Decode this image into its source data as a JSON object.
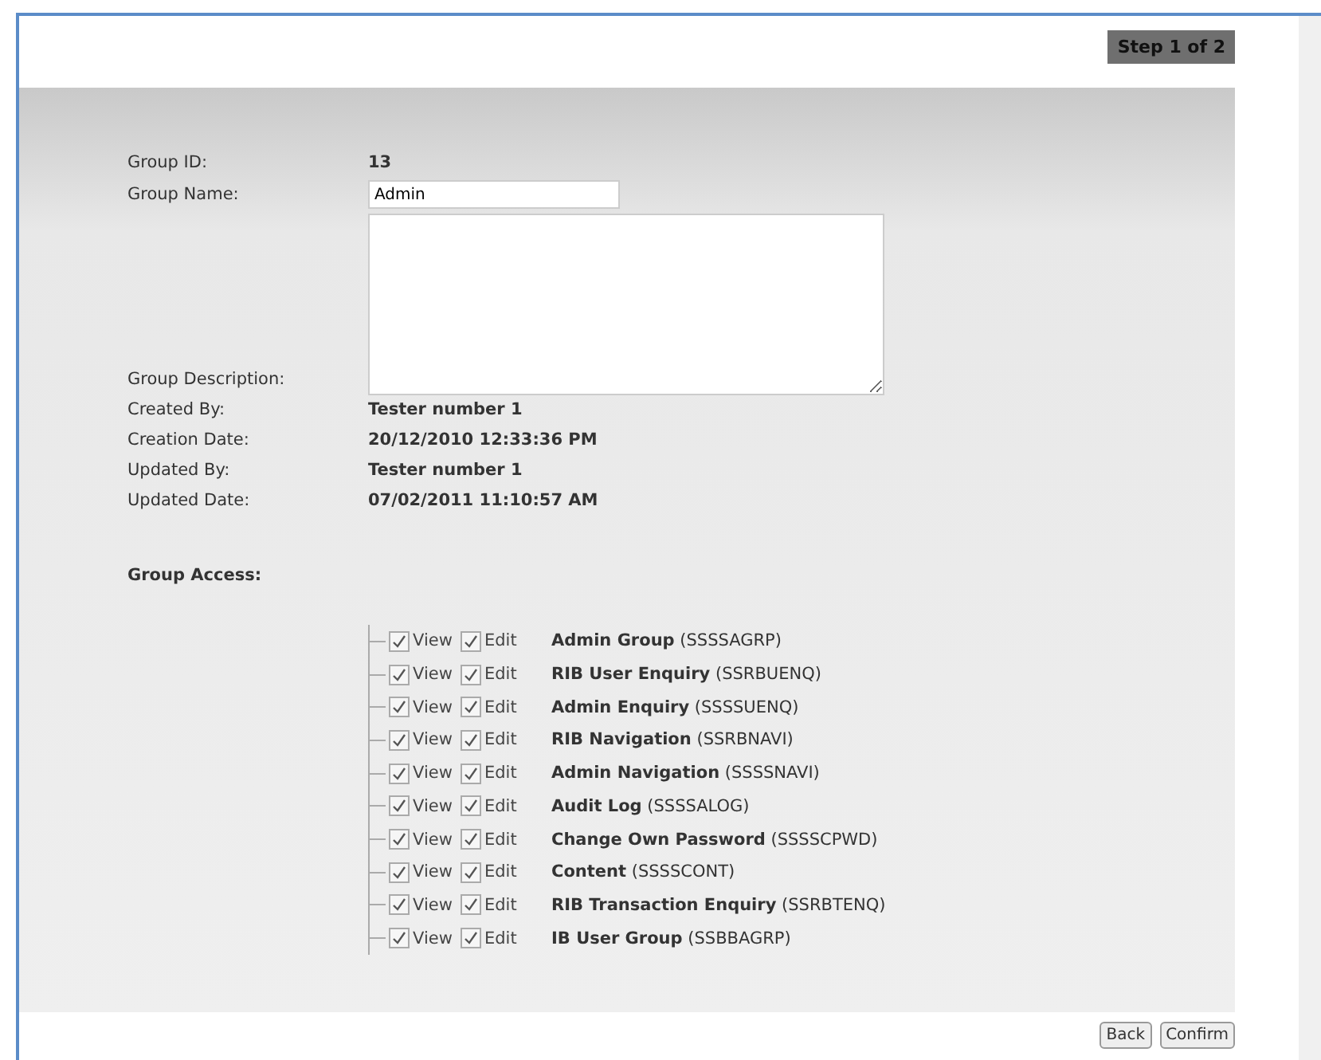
{
  "step_label": "Step 1 of 2",
  "fields": [
    {
      "label": "Group ID:",
      "kind": "text",
      "value": "13"
    },
    {
      "label": "Group Name:",
      "kind": "input",
      "value": "Admin"
    },
    {
      "label": "Group Description:",
      "kind": "textarea"
    },
    {
      "label": "Created By:",
      "kind": "text",
      "value": "Tester number 1"
    },
    {
      "label": "Creation Date:",
      "kind": "text",
      "value": "20/12/2010 12:33:36 PM"
    },
    {
      "label": "Updated By:",
      "kind": "text",
      "value": "Tester number 1"
    },
    {
      "label": "Updated Date:",
      "kind": "text",
      "value": "07/02/2011 11:10:57 AM"
    }
  ],
  "group_access": {
    "heading": "Group Access:",
    "items": [
      {
        "view_label": "View",
        "view_checked": true,
        "edit_label": "Edit",
        "edit_checked": true,
        "name": "Admin Group",
        "code": "(SSSSAGRP)"
      },
      {
        "view_label": "View",
        "view_checked": true,
        "edit_label": "Edit",
        "edit_checked": true,
        "name": "RIB User Enquiry",
        "code": "(SSRBUENQ)"
      },
      {
        "view_label": "View",
        "view_checked": true,
        "edit_label": "Edit",
        "edit_checked": true,
        "name": "Admin Enquiry",
        "code": "(SSSSUENQ)"
      },
      {
        "view_label": "View",
        "view_checked": true,
        "edit_label": "Edit",
        "edit_checked": true,
        "name": "RIB Navigation",
        "code": "(SSRBNAVI)"
      },
      {
        "view_label": "View",
        "view_checked": true,
        "edit_label": "Edit",
        "edit_checked": true,
        "name": "Admin Navigation",
        "code": "(SSSSNAVI)"
      },
      {
        "view_label": "View",
        "view_checked": true,
        "edit_label": "Edit",
        "edit_checked": true,
        "name": "Audit Log",
        "code": "(SSSSALOG)"
      },
      {
        "view_label": "View",
        "view_checked": true,
        "edit_label": "Edit",
        "edit_checked": true,
        "name": "Change Own Password",
        "code": "(SSSSCPWD)"
      },
      {
        "view_label": "View",
        "view_checked": true,
        "edit_label": "Edit",
        "edit_checked": true,
        "name": "Content",
        "code": "(SSSSCONT)"
      },
      {
        "view_label": "View",
        "view_checked": true,
        "edit_label": "Edit",
        "edit_checked": true,
        "name": "RIB Transaction Enquiry",
        "code": "(SSRBTENQ)"
      },
      {
        "view_label": "View",
        "view_checked": true,
        "edit_label": "Edit",
        "edit_checked": true,
        "name": "IB User Group",
        "code": "(SSBBAGRP)"
      }
    ]
  },
  "buttons": [
    "Back",
    "Confirm"
  ]
}
